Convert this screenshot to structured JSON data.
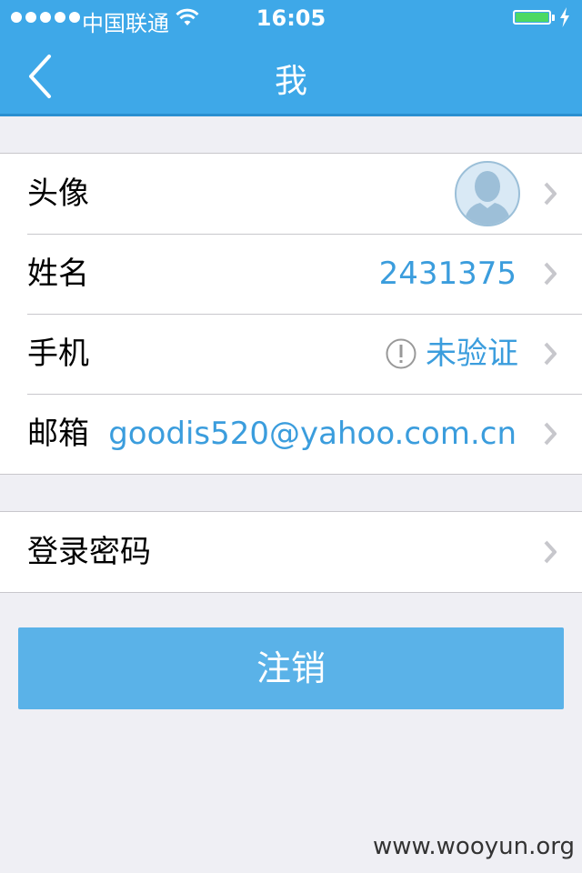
{
  "status_bar": {
    "carrier": "中国联通",
    "time": "16:05"
  },
  "nav": {
    "title": "我",
    "back_icon": "chevron-left-icon"
  },
  "profile": {
    "avatar_label": "头像",
    "name_label": "姓名",
    "name_value": "2431375",
    "phone_label": "手机",
    "phone_value": "未验证",
    "email_label": "邮箱",
    "email_value": "goodis520@yahoo.com.cn"
  },
  "security": {
    "password_label": "登录密码"
  },
  "logout_label": "注销",
  "watermark": "www.wooyun.org",
  "colors": {
    "nav_bg": "#3ea8e8",
    "accent_text": "#3b9ddd",
    "button_bg": "#5ab2e8",
    "battery": "#4cd964"
  }
}
